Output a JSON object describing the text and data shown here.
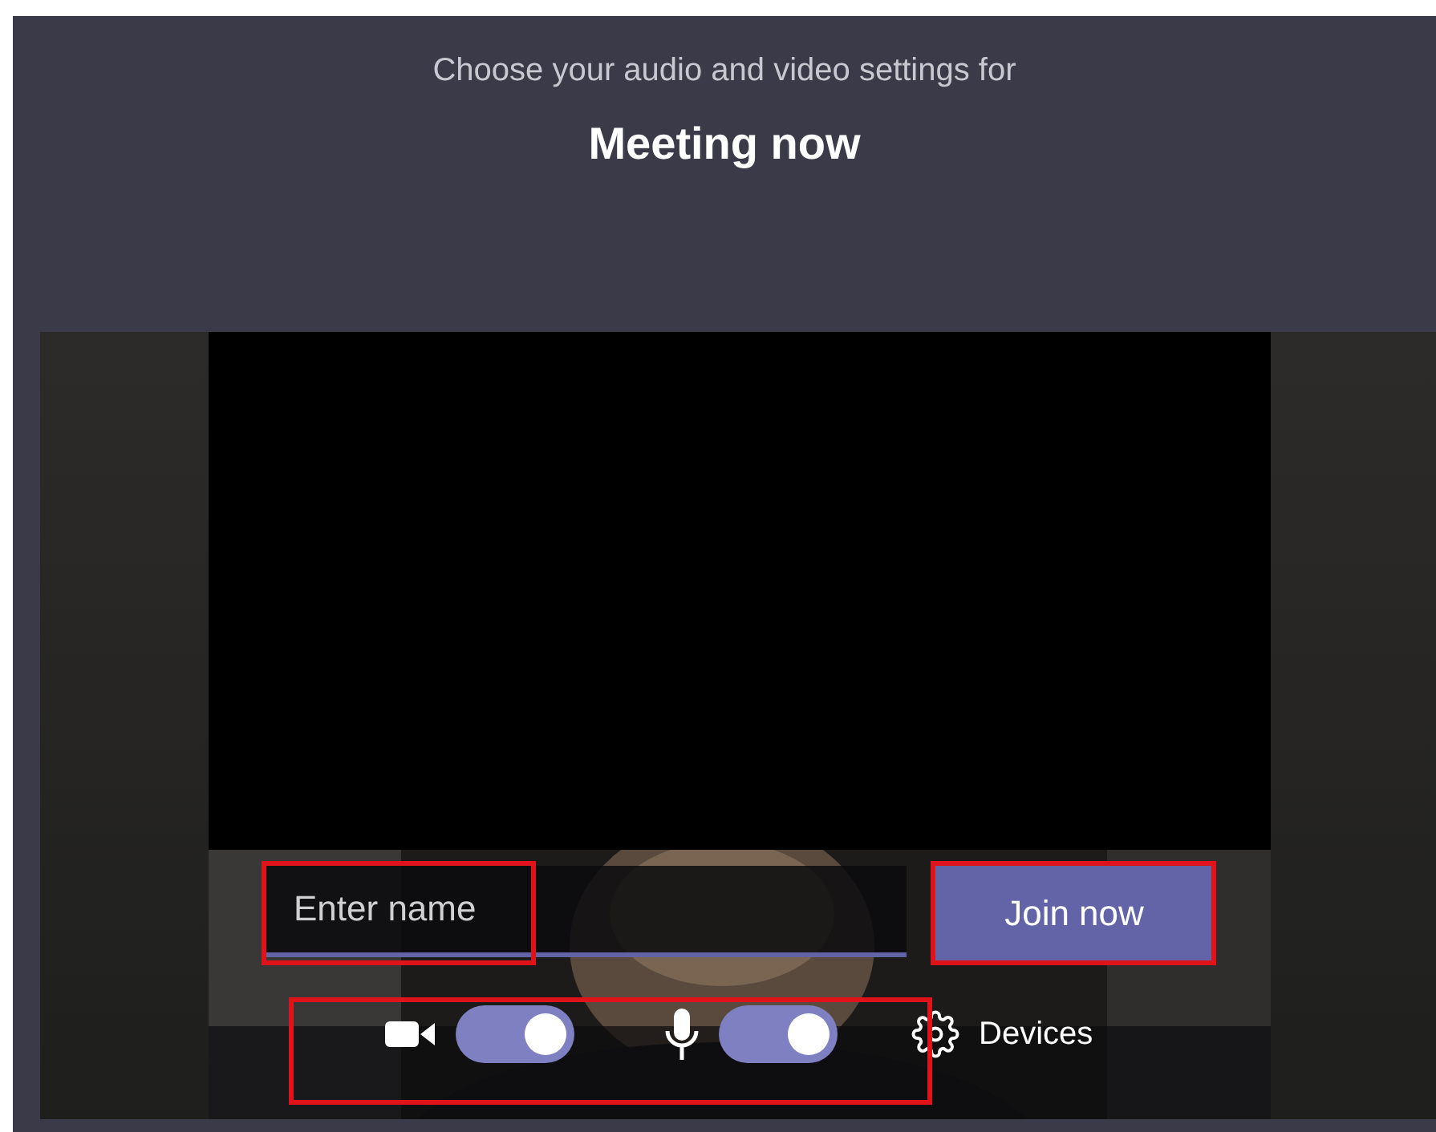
{
  "header": {
    "subtitle": "Choose your audio and video settings for",
    "title": "Meeting now"
  },
  "name_field": {
    "placeholder": "Enter name",
    "highlighted": true
  },
  "join_button": {
    "label": "Join now",
    "highlighted": true
  },
  "media_controls": {
    "highlighted": true,
    "toggles": [
      {
        "kind": "camera",
        "on": true
      },
      {
        "kind": "microphone",
        "on": true
      }
    ]
  },
  "devices_button": {
    "label": "Devices"
  }
}
